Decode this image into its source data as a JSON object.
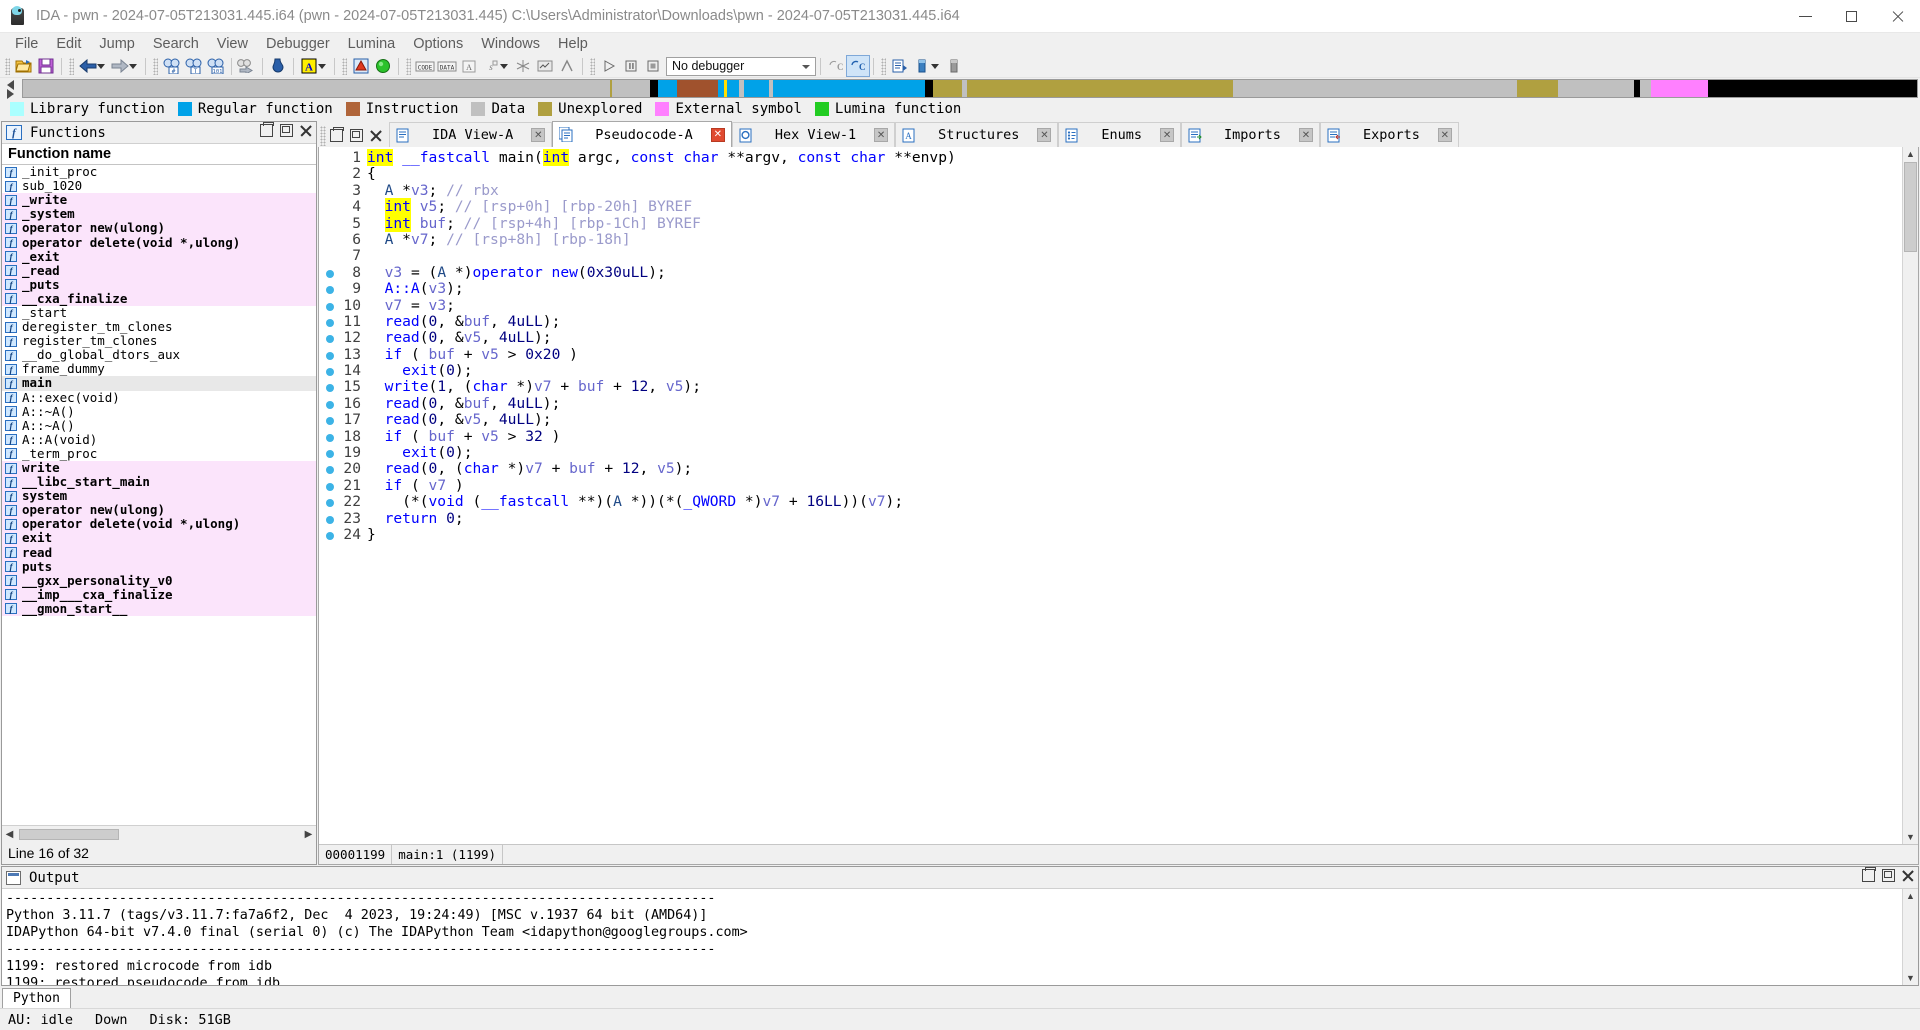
{
  "window": {
    "title": "IDA - pwn - 2024-07-05T213031.445.i64 (pwn - 2024-07-05T213031.445) C:\\Users\\Administrator\\Downloads\\pwn - 2024-07-05T213031.445.i64",
    "minimize_label": "–",
    "maximize_label": "□",
    "close_label": "✕"
  },
  "menu": {
    "items": [
      "File",
      "Edit",
      "Jump",
      "Search",
      "View",
      "Debugger",
      "Lumina",
      "Options",
      "Windows",
      "Help"
    ]
  },
  "toolbar": {
    "debugger_select_value": "No debugger",
    "icons": [
      "open-file-icon",
      "save-icon",
      "back-arrow-icon",
      "forward-arrow-icon",
      "search-hash-icon",
      "search-text-icon",
      "search-sequence-icon",
      "search-next-icon",
      "jump-down-icon",
      "text-style-icon",
      "warnings-icon",
      "lumina-status-icon",
      "code-icon",
      "data-icon",
      "ascii-icon",
      "struct-icon",
      "undefine-icon",
      "func-chart-icon",
      "graph-icon",
      "xrefs-icon",
      "run-icon",
      "pause-icon",
      "stop-icon",
      "recompile-icon",
      "decompile-icon",
      "list-icon",
      "stack-icon",
      "memory-icon"
    ]
  },
  "navband": {
    "cursor_position_pct": 37,
    "segments": [
      {
        "color": "#c0c0c0",
        "width_pct": 31.0,
        "kind": "Unexplored"
      },
      {
        "color": "#b0a040",
        "width_pct": 0.12,
        "kind": "Unexplored"
      },
      {
        "color": "#c0c0c0",
        "width_pct": 2.0,
        "kind": "Data"
      },
      {
        "color": "#000000",
        "width_pct": 0.4,
        "kind": "Instruction"
      },
      {
        "color": "#00a2e8",
        "width_pct": 1.0,
        "kind": "Regular function"
      },
      {
        "color": "#a0522d",
        "width_pct": 2.2,
        "kind": "Instruction"
      },
      {
        "color": "#00a2e8",
        "width_pct": 1.1,
        "kind": "Regular function"
      },
      {
        "color": "#c0c0c0",
        "width_pct": 0.25,
        "kind": "Data"
      },
      {
        "color": "#00a2e8",
        "width_pct": 1.3,
        "kind": "Regular function"
      },
      {
        "color": "#c0c0c0",
        "width_pct": 0.25,
        "kind": "Data"
      },
      {
        "color": "#00a2e8",
        "width_pct": 8.0,
        "kind": "Regular function"
      },
      {
        "color": "#000000",
        "width_pct": 0.45,
        "kind": "Instruction"
      },
      {
        "color": "#b0a040",
        "width_pct": 1.5,
        "kind": "Unexplored"
      },
      {
        "color": "#c0c0c0",
        "width_pct": 0.3,
        "kind": "Data"
      },
      {
        "color": "#b0a040",
        "width_pct": 14.0,
        "kind": "Unexplored"
      },
      {
        "color": "#c0c0c0",
        "width_pct": 15.0,
        "kind": "Data"
      },
      {
        "color": "#b0a040",
        "width_pct": 2.2,
        "kind": "Unexplored"
      },
      {
        "color": "#c0c0c0",
        "width_pct": 4.0,
        "kind": "Data"
      },
      {
        "color": "#000000",
        "width_pct": 0.3,
        "kind": "Instruction"
      },
      {
        "color": "#c0c0c0",
        "width_pct": 0.6,
        "kind": "Data"
      },
      {
        "color": "#ff80ff",
        "width_pct": 3.0,
        "kind": "External symbol"
      },
      {
        "color": "#000000",
        "width_pct": 11.0,
        "kind": "Instruction"
      }
    ]
  },
  "legend": {
    "items": [
      {
        "label": "Library function",
        "color": "#aaffff"
      },
      {
        "label": "Regular function",
        "color": "#00a2e8"
      },
      {
        "label": "Instruction",
        "color": "#b0653a"
      },
      {
        "label": "Data",
        "color": "#c0c0c0"
      },
      {
        "label": "Unexplored",
        "color": "#b0a040"
      },
      {
        "label": "External symbol",
        "color": "#ff80ff"
      },
      {
        "label": "Lumina function",
        "color": "#22cc22"
      }
    ]
  },
  "functions_panel": {
    "title": "Functions",
    "icon": "function-f-icon",
    "column_header": "Function name",
    "status": "Line 16 of 32",
    "restore_label": "❐",
    "float_label": "❐",
    "close_label": "✕",
    "rows": [
      {
        "name": "_init_proc",
        "style": "normal"
      },
      {
        "name": "sub_1020",
        "style": "normal"
      },
      {
        "name": "_write",
        "style": "lib"
      },
      {
        "name": "_system",
        "style": "lib"
      },
      {
        "name": "operator new(ulong)",
        "style": "lib"
      },
      {
        "name": "operator delete(void *,ulong)",
        "style": "lib"
      },
      {
        "name": "_exit",
        "style": "lib"
      },
      {
        "name": "_read",
        "style": "lib"
      },
      {
        "name": "_puts",
        "style": "lib"
      },
      {
        "name": "__cxa_finalize",
        "style": "lib"
      },
      {
        "name": "_start",
        "style": "normal"
      },
      {
        "name": "deregister_tm_clones",
        "style": "normal"
      },
      {
        "name": "register_tm_clones",
        "style": "normal"
      },
      {
        "name": "__do_global_dtors_aux",
        "style": "normal"
      },
      {
        "name": "frame_dummy",
        "style": "normal"
      },
      {
        "name": "main",
        "style": "sel"
      },
      {
        "name": "A::exec(void)",
        "style": "normal"
      },
      {
        "name": "A::~A()",
        "style": "normal"
      },
      {
        "name": "A::~A()",
        "style": "normal"
      },
      {
        "name": "A::A(void)",
        "style": "normal"
      },
      {
        "name": "_term_proc",
        "style": "normal"
      },
      {
        "name": "write",
        "style": "lib"
      },
      {
        "name": "__libc_start_main",
        "style": "lib"
      },
      {
        "name": "system",
        "style": "lib"
      },
      {
        "name": "operator new(ulong)",
        "style": "lib"
      },
      {
        "name": "operator delete(void *,ulong)",
        "style": "lib"
      },
      {
        "name": "exit",
        "style": "lib"
      },
      {
        "name": "read",
        "style": "lib"
      },
      {
        "name": "puts",
        "style": "lib"
      },
      {
        "name": "__gxx_personality_v0",
        "style": "lib"
      },
      {
        "name": "__imp___cxa_finalize",
        "style": "lib"
      },
      {
        "name": "__gmon_start__",
        "style": "lib"
      }
    ]
  },
  "editor": {
    "tabs": [
      {
        "label": "IDA View-A",
        "icon": "ida-view-icon",
        "active": false,
        "close_style": "grey"
      },
      {
        "label": "Pseudocode-A",
        "icon": "pseudocode-icon",
        "active": true,
        "close_style": "red"
      },
      {
        "label": "Hex View-1",
        "icon": "hex-view-icon",
        "active": false,
        "close_style": "grey"
      },
      {
        "label": "Structures",
        "icon": "structures-icon",
        "active": false,
        "close_style": "grey"
      },
      {
        "label": "Enums",
        "icon": "enums-icon",
        "active": false,
        "close_style": "grey"
      },
      {
        "label": "Imports",
        "icon": "imports-icon",
        "active": false,
        "close_style": "grey"
      },
      {
        "label": "Exports",
        "icon": "exports-icon",
        "active": false,
        "close_style": "grey"
      }
    ],
    "status": {
      "address": "00001199",
      "location": "main:1  (1199)"
    },
    "close_x": "✕"
  },
  "pseudocode": {
    "lines": [
      {
        "n": "1",
        "bp": false,
        "html": "<span class=\"hl\">int</span> <span class=\"kw\">__fastcall</span> <span class=\"pl\">main(</span><span class=\"hl\">int</span> <span class=\"pl\">argc, </span><span class=\"kw\">const char</span> <span class=\"pl\">**argv, </span><span class=\"kw\">const char</span> <span class=\"pl\">**envp)</span>"
      },
      {
        "n": "2",
        "bp": false,
        "html": "<span class=\"pl\">{</span>"
      },
      {
        "n": "3",
        "bp": false,
        "html": "<span class=\"pl\">  </span><span class=\"typ\">A</span> <span class=\"pl\">*</span><span class=\"var\">v3</span><span class=\"pl\">; </span><span class=\"cmt\">// rbx</span>"
      },
      {
        "n": "4",
        "bp": false,
        "html": "<span class=\"pl\">  </span><span class=\"hl\">int</span> <span class=\"var\">v5</span><span class=\"pl\">; </span><span class=\"cmt\">// [rsp+0h] [rbp-20h] BYREF</span>"
      },
      {
        "n": "5",
        "bp": false,
        "html": "<span class=\"pl\">  </span><span class=\"hl\">int</span> <span class=\"var\">buf</span><span class=\"pl\">; </span><span class=\"cmt\">// [rsp+4h] [rbp-1Ch] BYREF</span>"
      },
      {
        "n": "6",
        "bp": false,
        "html": "<span class=\"pl\">  </span><span class=\"typ\">A</span> <span class=\"pl\">*</span><span class=\"var\">v7</span><span class=\"pl\">; </span><span class=\"cmt\">// [rsp+8h] [rbp-18h]</span>"
      },
      {
        "n": "7",
        "bp": false,
        "html": ""
      },
      {
        "n": "8",
        "bp": true,
        "html": "<span class=\"pl\">  </span><span class=\"var\">v3</span> <span class=\"pl\">= (</span><span class=\"typ\">A</span> <span class=\"pl\">*)</span><span class=\"fn\">operator new</span><span class=\"pl\">(</span><span class=\"num\">0x30uLL</span><span class=\"pl\">);</span>"
      },
      {
        "n": "9",
        "bp": true,
        "html": "<span class=\"pl\">  </span><span class=\"fn\">A::A</span><span class=\"pl\">(</span><span class=\"var\">v3</span><span class=\"pl\">);</span>"
      },
      {
        "n": "10",
        "bp": true,
        "html": "<span class=\"pl\">  </span><span class=\"var\">v7</span> <span class=\"pl\">= </span><span class=\"var\">v3</span><span class=\"pl\">;</span>"
      },
      {
        "n": "11",
        "bp": true,
        "html": "<span class=\"pl\">  </span><span class=\"fn\">read</span><span class=\"pl\">(</span><span class=\"num\">0</span><span class=\"pl\">, &amp;</span><span class=\"var\">buf</span><span class=\"pl\">, </span><span class=\"num\">4uLL</span><span class=\"pl\">);</span>"
      },
      {
        "n": "12",
        "bp": true,
        "html": "<span class=\"pl\">  </span><span class=\"fn\">read</span><span class=\"pl\">(</span><span class=\"num\">0</span><span class=\"pl\">, &amp;</span><span class=\"var\">v5</span><span class=\"pl\">, </span><span class=\"num\">4uLL</span><span class=\"pl\">);</span>"
      },
      {
        "n": "13",
        "bp": true,
        "html": "<span class=\"pl\">  </span><span class=\"kw\">if</span> <span class=\"pl\">( </span><span class=\"var\">buf</span> <span class=\"pl\">+ </span><span class=\"var\">v5</span> <span class=\"pl\">&gt; </span><span class=\"num\">0x20</span> <span class=\"pl\">)</span>"
      },
      {
        "n": "14",
        "bp": true,
        "html": "<span class=\"pl\">    </span><span class=\"fn\">exit</span><span class=\"pl\">(</span><span class=\"num\">0</span><span class=\"pl\">);</span>"
      },
      {
        "n": "15",
        "bp": true,
        "html": "<span class=\"pl\">  </span><span class=\"fn\">write</span><span class=\"pl\">(</span><span class=\"num\">1</span><span class=\"pl\">, (</span><span class=\"kw\">char</span> <span class=\"pl\">*)</span><span class=\"var\">v7</span> <span class=\"pl\">+ </span><span class=\"var\">buf</span> <span class=\"pl\">+ </span><span class=\"num\">12</span><span class=\"pl\">, </span><span class=\"var\">v5</span><span class=\"pl\">);</span>"
      },
      {
        "n": "16",
        "bp": true,
        "html": "<span class=\"pl\">  </span><span class=\"fn\">read</span><span class=\"pl\">(</span><span class=\"num\">0</span><span class=\"pl\">, &amp;</span><span class=\"var\">buf</span><span class=\"pl\">, </span><span class=\"num\">4uLL</span><span class=\"pl\">);</span>"
      },
      {
        "n": "17",
        "bp": true,
        "html": "<span class=\"pl\">  </span><span class=\"fn\">read</span><span class=\"pl\">(</span><span class=\"num\">0</span><span class=\"pl\">, &amp;</span><span class=\"var\">v5</span><span class=\"pl\">, </span><span class=\"num\">4uLL</span><span class=\"pl\">);</span>"
      },
      {
        "n": "18",
        "bp": true,
        "html": "<span class=\"pl\">  </span><span class=\"kw\">if</span> <span class=\"pl\">( </span><span class=\"var\">buf</span> <span class=\"pl\">+ </span><span class=\"var\">v5</span> <span class=\"pl\">&gt; </span><span class=\"num\">32</span> <span class=\"pl\">)</span>"
      },
      {
        "n": "19",
        "bp": true,
        "html": "<span class=\"pl\">    </span><span class=\"fn\">exit</span><span class=\"pl\">(</span><span class=\"num\">0</span><span class=\"pl\">);</span>"
      },
      {
        "n": "20",
        "bp": true,
        "html": "<span class=\"pl\">  </span><span class=\"fn\">read</span><span class=\"pl\">(</span><span class=\"num\">0</span><span class=\"pl\">, (</span><span class=\"kw\">char</span> <span class=\"pl\">*)</span><span class=\"var\">v7</span> <span class=\"pl\">+ </span><span class=\"var\">buf</span> <span class=\"pl\">+ </span><span class=\"num\">12</span><span class=\"pl\">, </span><span class=\"var\">v5</span><span class=\"pl\">);</span>"
      },
      {
        "n": "21",
        "bp": true,
        "html": "<span class=\"pl\">  </span><span class=\"kw\">if</span> <span class=\"pl\">( </span><span class=\"var\">v7</span> <span class=\"pl\">)</span>"
      },
      {
        "n": "22",
        "bp": true,
        "html": "<span class=\"pl\">    (*(</span><span class=\"kw\">void</span> <span class=\"pl\">(</span><span class=\"kw\">__fastcall</span> <span class=\"pl\">**)(</span><span class=\"typ\">A</span> <span class=\"pl\">*))(*(</span><span class=\"kw\">_QWORD</span> <span class=\"pl\">*)</span><span class=\"var\">v7</span> <span class=\"pl\">+ </span><span class=\"num\">16LL</span><span class=\"pl\">))(</span><span class=\"var\">v7</span><span class=\"pl\">);</span>"
      },
      {
        "n": "23",
        "bp": true,
        "html": "<span class=\"pl\">  </span><span class=\"kw\">return</span> <span class=\"num\">0</span><span class=\"pl\">;</span>"
      },
      {
        "n": "24",
        "bp": true,
        "html": "<span class=\"pl\">}</span>"
      }
    ]
  },
  "output": {
    "title": "Output",
    "restore_label": "❐",
    "float_label": "❐",
    "close_label": "✕",
    "lines": [
      "----------------------------------------------------------------------------------------",
      "Python 3.11.7 (tags/v3.11.7:fa7a6f2, Dec  4 2023, 19:24:49) [MSC v.1937 64 bit (AMD64)]",
      "IDAPython 64-bit v7.4.0 final (serial 0) (c) The IDAPython Team <idapython@googlegroups.com>",
      "----------------------------------------------------------------------------------------",
      "1199: restored microcode from idb",
      "1199: restored pseudocode from idb"
    ],
    "input_tab": "Python"
  },
  "statusbar": {
    "au": "AU:  idle",
    "down": "Down",
    "disk": "Disk: 51GB"
  },
  "colors": {
    "library_function": "#aaffff",
    "regular_function": "#00a2e8",
    "instruction": "#b0653a",
    "data": "#c0c0c0",
    "unexplored": "#b0a040",
    "external_symbol": "#ff80ff",
    "lumina_function": "#22cc22",
    "highlight_yellow": "#ffff00",
    "lib_row_bg": "#fbe4fb",
    "selected_row_bg": "#e8e8e8"
  }
}
